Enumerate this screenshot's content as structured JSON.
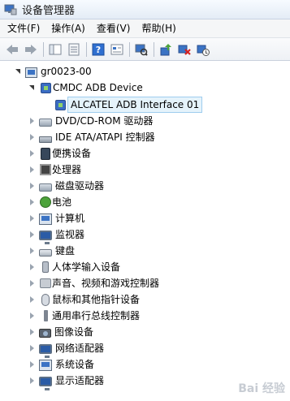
{
  "window": {
    "title": "设备管理器"
  },
  "menu": [
    "文件(F)",
    "操作(A)",
    "查看(V)",
    "帮助(H)"
  ],
  "toolbar": {
    "buttons": [
      "back-icon",
      "forward-icon",
      "properties-icon",
      "show-icon",
      "help-icon",
      "view-icon",
      "scan-icon",
      "update-driver-icon",
      "uninstall-icon",
      "disable-icon"
    ]
  },
  "tree": {
    "root": "gr0023-00",
    "cmdc": "CMDC ADB Device",
    "alcatel": "ALCATEL ADB Interface 01",
    "items": [
      "DVD/CD-ROM 驱动器",
      "IDE ATA/ATAPI 控制器",
      "便携设备",
      "处理器",
      "磁盘驱动器",
      "电池",
      "计算机",
      "监视器",
      "键盘",
      "人体学输入设备",
      "声音、视频和游戏控制器",
      "鼠标和其他指针设备",
      "通用串行总线控制器",
      "图像设备",
      "网络适配器",
      "系统设备",
      "显示适配器"
    ]
  },
  "watermark": "Bai 经验"
}
